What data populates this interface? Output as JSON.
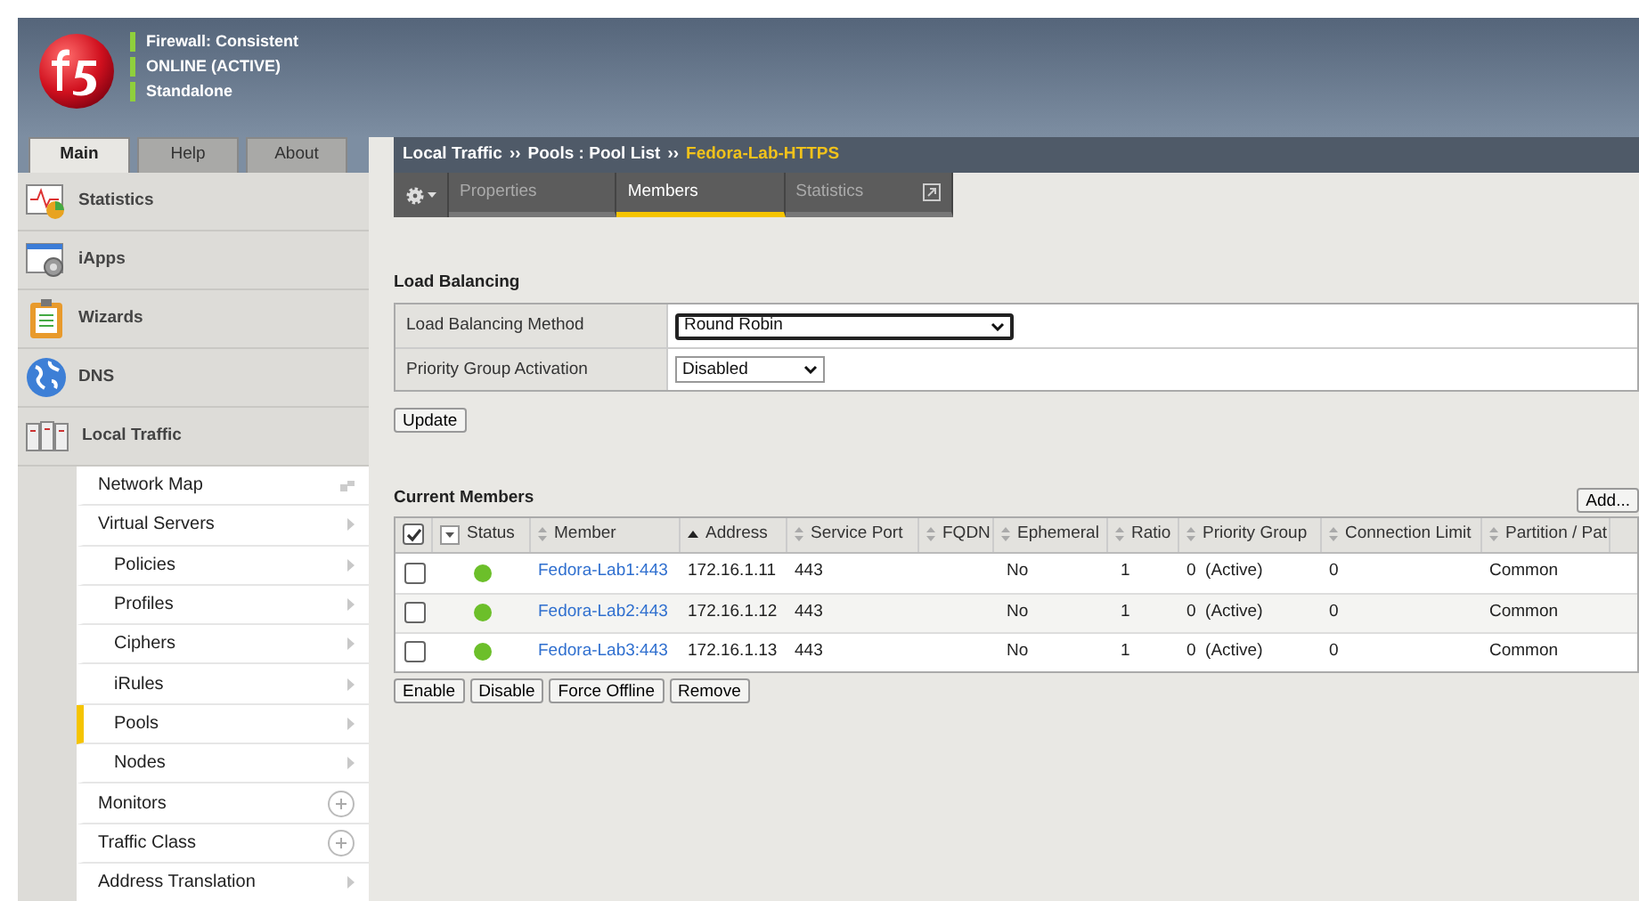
{
  "header": {
    "status_lines": [
      "Firewall: Consistent",
      "ONLINE (ACTIVE)",
      "Standalone"
    ]
  },
  "top_tabs": [
    {
      "label": "Main",
      "selected": true
    },
    {
      "label": "Help",
      "selected": false
    },
    {
      "label": "About",
      "selected": false
    }
  ],
  "sidebar": {
    "sections": [
      {
        "label": "Statistics"
      },
      {
        "label": "iApps"
      },
      {
        "label": "Wizards"
      },
      {
        "label": "DNS"
      },
      {
        "label": "Local Traffic"
      }
    ],
    "items": [
      {
        "label": "Network Map",
        "kind": "map",
        "selected": false
      },
      {
        "label": "Virtual Servers",
        "kind": "arrow",
        "selected": false,
        "children": [
          {
            "label": "Policies",
            "kind": "arrow",
            "selected": false
          },
          {
            "label": "Profiles",
            "kind": "arrow",
            "selected": false
          },
          {
            "label": "Ciphers",
            "kind": "arrow",
            "selected": false
          },
          {
            "label": "iRules",
            "kind": "arrow",
            "selected": false
          },
          {
            "label": "Pools",
            "kind": "arrow",
            "selected": true
          },
          {
            "label": "Nodes",
            "kind": "arrow",
            "selected": false
          }
        ]
      },
      {
        "label": "Monitors",
        "kind": "add",
        "selected": false
      },
      {
        "label": "Traffic Class",
        "kind": "add",
        "selected": false
      },
      {
        "label": "Address Translation",
        "kind": "arrow",
        "selected": false
      }
    ]
  },
  "breadcrumb": {
    "parts": [
      "Local Traffic",
      "››",
      "Pools : Pool List",
      "››"
    ],
    "current": "Fedora-Lab-HTTPS"
  },
  "tabs": [
    {
      "label": "Properties",
      "selected": false
    },
    {
      "label": "Members",
      "selected": true
    },
    {
      "label": "Statistics",
      "selected": false
    }
  ],
  "load_balancing": {
    "title": "Load Balancing",
    "fields": [
      {
        "label": "Load Balancing Method",
        "value": "Round Robin",
        "focused": true
      },
      {
        "label": "Priority Group Activation",
        "value": "Disabled",
        "focused": false
      }
    ],
    "button": "Update"
  },
  "members": {
    "title": "Current Members",
    "add_button": "Add...",
    "columns": [
      "Status",
      "Member",
      "Address",
      "Service Port",
      "FQDN",
      "Ephemeral",
      "Ratio",
      "Priority Group",
      "Connection Limit",
      "Partition / Pat"
    ],
    "header_checked": true,
    "rows": [
      {
        "checked": false,
        "color": "#6cbf2a",
        "member": "Fedora-Lab1:443",
        "address": "172.16.1.11",
        "port": "443",
        "ephemeral": "No",
        "ratio": "1",
        "priority": "0  (Active)",
        "limit": "0",
        "partition": "Common"
      },
      {
        "checked": false,
        "color": "#6cbf2a",
        "member": "Fedora-Lab2:443",
        "address": "172.16.1.12",
        "port": "443",
        "ephemeral": "No",
        "ratio": "1",
        "priority": "0  (Active)",
        "limit": "0",
        "partition": "Common"
      },
      {
        "checked": false,
        "color": "#6cbf2a",
        "member": "Fedora-Lab3:443",
        "address": "172.16.1.13",
        "port": "443",
        "ephemeral": "No",
        "ratio": "1",
        "priority": "0  (Active)",
        "limit": "0",
        "partition": "Common"
      }
    ],
    "buttons": [
      "Enable",
      "Disable",
      "Force Offline",
      "Remove"
    ]
  }
}
